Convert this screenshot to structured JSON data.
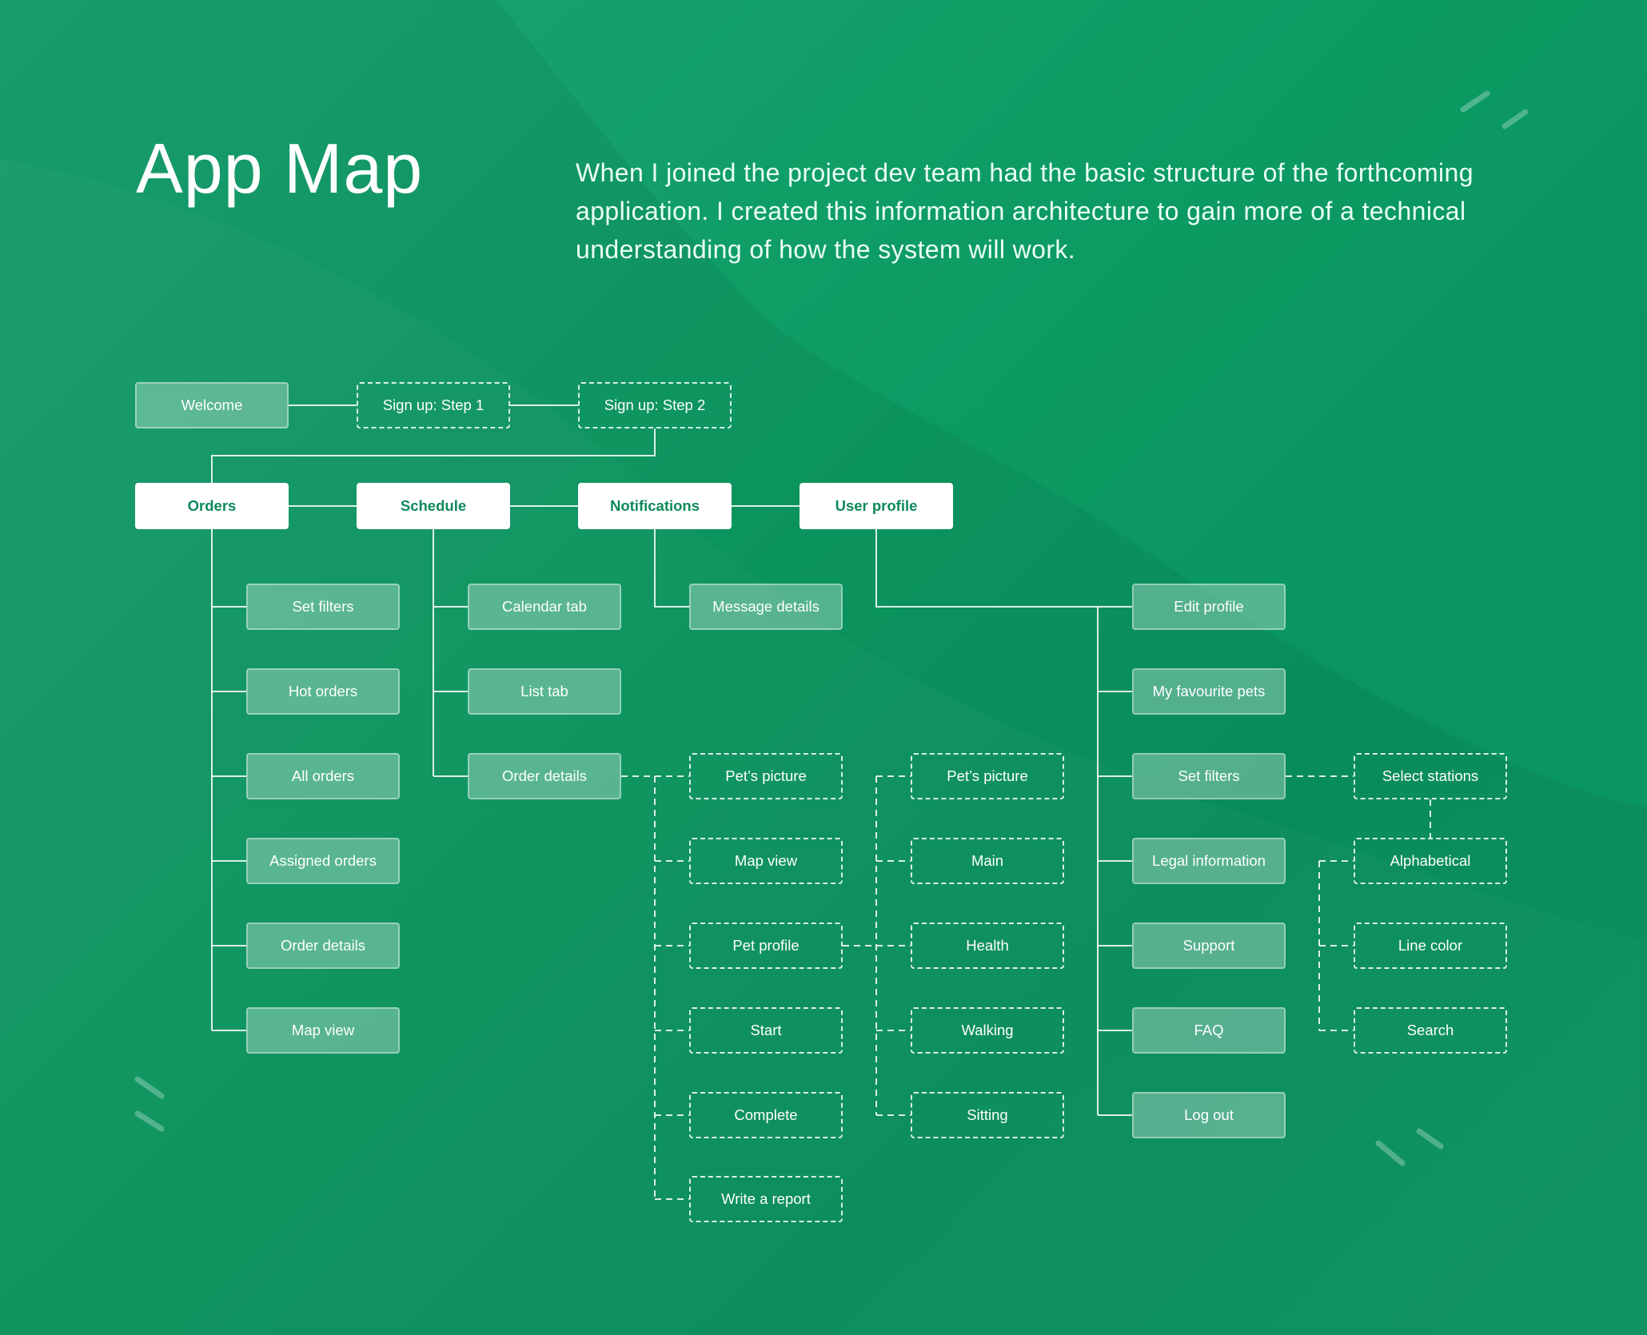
{
  "header": {
    "title": "App Map",
    "intro": "When I joined the project dev team had the basic structure of the forthcoming application. I created this information architecture to gain more of a technical understanding of how the system will work."
  },
  "colors": {
    "background_start": "#1ba572",
    "background_end": "#0a9460",
    "main_node_text": "#0d8a5a",
    "line": "#ffffff"
  },
  "onboarding": {
    "welcome": "Welcome",
    "signup_step1": "Sign up: Step 1",
    "signup_step2": "Sign up: Step 2"
  },
  "main_nav": {
    "orders": "Orders",
    "schedule": "Schedule",
    "notifications": "Notifications",
    "user_profile": "User profile"
  },
  "orders_children": [
    "Set filters",
    "Hot orders",
    "All orders",
    "Assigned orders",
    "Order details",
    "Map view"
  ],
  "schedule_children": [
    "Calendar tab",
    "List tab",
    "Order details"
  ],
  "notifications_children": [
    "Message details"
  ],
  "order_details_children": [
    "Pet’s picture",
    "Map view",
    "Pet profile",
    "Start",
    "Complete",
    "Write a report"
  ],
  "pet_profile_children": [
    "Pet’s picture",
    "Main",
    "Health",
    "Walking",
    "Sitting"
  ],
  "user_profile_children": [
    "Edit profile",
    "My favourite pets",
    "Set filters",
    "Legal information",
    "Support",
    "FAQ",
    "Log out"
  ],
  "set_filters_children": [
    "Select stations",
    "Alphabetical",
    "Line color",
    "Search"
  ]
}
